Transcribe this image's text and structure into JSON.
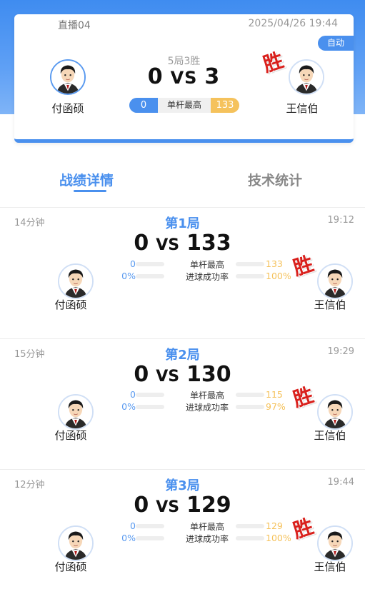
{
  "header": {
    "room": "直播04",
    "datetime": "2025/04/26 19:44",
    "mode": "自动",
    "format": "5局3胜",
    "score_left": "0",
    "score_vs": "VS",
    "score_right": "3",
    "player_left": "付函硕",
    "player_right": "王信伯",
    "win_label": "胜",
    "highbreak": {
      "left": "0",
      "label": "单杆最高",
      "right": "133"
    }
  },
  "tabs": [
    {
      "label": "战绩详情",
      "active": true
    },
    {
      "label": "技术统计",
      "active": false
    }
  ],
  "games": [
    {
      "duration": "14分钟",
      "title": "第1局",
      "time": "19:12",
      "score_left": "0",
      "vs": "VS",
      "score_right": "133",
      "stats": [
        {
          "label": "单杆最高",
          "left": "0",
          "right": "133",
          "right_fraction": 1.0
        },
        {
          "label": "进球成功率",
          "left": "0%",
          "right": "100%",
          "right_fraction": 1.0
        }
      ],
      "player_left": "付函硕",
      "player_right": "王信伯",
      "win_label": "胜"
    },
    {
      "duration": "15分钟",
      "title": "第2局",
      "time": "19:29",
      "score_left": "0",
      "vs": "VS",
      "score_right": "130",
      "stats": [
        {
          "label": "单杆最高",
          "left": "0",
          "right": "115",
          "right_fraction": 1.0
        },
        {
          "label": "进球成功率",
          "left": "0%",
          "right": "97%",
          "right_fraction": 0.97
        }
      ],
      "player_left": "付函硕",
      "player_right": "王信伯",
      "win_label": "胜"
    },
    {
      "duration": "12分钟",
      "title": "第3局",
      "time": "19:44",
      "score_left": "0",
      "vs": "VS",
      "score_right": "129",
      "stats": [
        {
          "label": "单杆最高",
          "left": "0",
          "right": "129",
          "right_fraction": 1.0
        },
        {
          "label": "进球成功率",
          "left": "0%",
          "right": "100%",
          "right_fraction": 1.0
        }
      ],
      "player_left": "付函硕",
      "player_right": "王信伯",
      "win_label": "胜"
    }
  ],
  "colors": {
    "accent": "#4a90ee",
    "win": "#d9201c",
    "gold": "#f5c25c"
  }
}
